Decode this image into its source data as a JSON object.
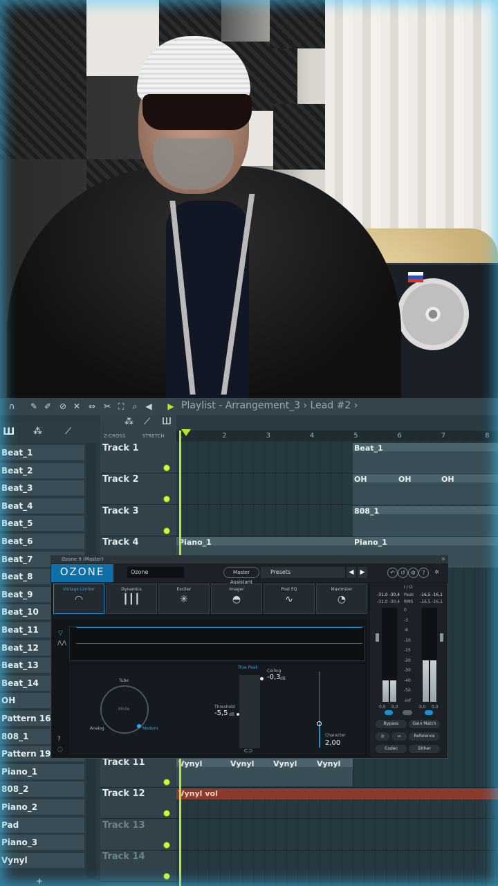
{
  "toolbar": {
    "title": "Playlist - Arrangement_3 › Lead #2 ›"
  },
  "ruler": {
    "snap_labels": [
      "Z-CROSS",
      "STRETCH"
    ],
    "bars": [
      "1",
      "2",
      "3",
      "4",
      "5",
      "6",
      "7",
      "8"
    ]
  },
  "sidebar": {
    "items": [
      "Beat_1",
      "Beat_2",
      "Beat_3",
      "Beat_4",
      "Beat_5",
      "Beat_6",
      "Beat_7",
      "Beat_8",
      "Beat_9",
      "Beat_10",
      "Beat_11",
      "Beat_12",
      "Beat_13",
      "Beat_14",
      "OH",
      "Pattern 16",
      "808_1",
      "Pattern 19",
      "Piano_1",
      "808_2",
      "Piano_2",
      "Pad",
      "Piano_3",
      "Vynyl"
    ],
    "add_label": "+"
  },
  "tracks": [
    "Track 1",
    "Track 2",
    "Track 3",
    "Track 4",
    "Track 11",
    "Track 12",
    "Track 13",
    "Track 14"
  ],
  "clips": {
    "beat": "Beat_1",
    "oh": "OH",
    "bass": "808_1",
    "piano": "Piano_1",
    "vynyl": "Vynyl",
    "automation": "Vynyl vol"
  },
  "ozone": {
    "window_title": "Ozone 9 (Master)",
    "logo": "OZONE",
    "preset_name": "Ozone",
    "master_assistant": "Master Assistant",
    "presets_label": "Presets",
    "modules": [
      "Vintage Limiter",
      "Dynamics",
      "Exciter",
      "Imager",
      "Post EQ",
      "Maximizer"
    ],
    "mode_labels": {
      "tube": "Tube",
      "mode": "Mode",
      "analog": "Analog",
      "modern": "Modern"
    },
    "true_peak": "True Peak",
    "ceiling_label": "Ceiling",
    "ceiling_value": "-0,3",
    "threshold_label": "Threshold",
    "threshold_value": "-5,5",
    "db_unit": "dB",
    "character_label": "Character",
    "character_value": "2,00",
    "meter": {
      "io": "I / O",
      "peak": "Peak",
      "rms": "RMS",
      "in_peak": "-31,0  -30,4",
      "out_peak": "-16,5  -16,1",
      "in_rms": "-31,0  -30,4",
      "out_rms": "-16,5  -16,1",
      "scale": [
        "0",
        "-3",
        "-6",
        "-10",
        "-15",
        "-20",
        "-30",
        "-40",
        "-50",
        "-Inf"
      ],
      "bottom_values": [
        "0,0",
        "0,0",
        "0,0",
        "0,0"
      ],
      "in_level": 0.23,
      "out_level": 0.44
    },
    "buttons": {
      "bypass": "Bypass",
      "gain_match": "Gain Match",
      "reference": "Reference",
      "codec": "Codec",
      "dither": "Dither"
    }
  }
}
